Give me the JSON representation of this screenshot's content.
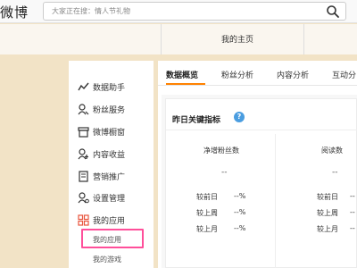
{
  "header": {
    "logo_text": "微博",
    "search_placeholder": "大家正在搜：情人节礼物"
  },
  "nav": {
    "my_home": "我的主页"
  },
  "sidebar": {
    "items": [
      {
        "label": "数据助手",
        "icon": "chart-line-icon"
      },
      {
        "label": "粉丝服务",
        "icon": "fans-icon"
      },
      {
        "label": "微博橱窗",
        "icon": "shop-window-icon"
      },
      {
        "label": "内容收益",
        "icon": "income-icon"
      },
      {
        "label": "营销推广",
        "icon": "promotion-icon"
      },
      {
        "label": "设置管理",
        "icon": "settings-icon"
      },
      {
        "label": "我的应用",
        "icon": "apps-icon"
      }
    ],
    "sub_items": [
      {
        "label": "我的应用"
      },
      {
        "label": "我的游戏"
      }
    ]
  },
  "tabs": [
    {
      "label": "数据概览",
      "active": true
    },
    {
      "label": "粉丝分析",
      "active": false
    },
    {
      "label": "内容分析",
      "active": false
    },
    {
      "label": "互动分",
      "active": false
    }
  ],
  "card": {
    "title": "昨日关键指标",
    "columns": [
      {
        "header": "净增粉丝数",
        "value": "--",
        "compare": [
          {
            "label": "较前日",
            "value": "--%"
          },
          {
            "label": "较上周",
            "value": "--%"
          },
          {
            "label": "较上月",
            "value": "--%"
          }
        ]
      },
      {
        "header": "阅读数",
        "value": "--",
        "compare": [
          {
            "label": "较前日",
            "value": "--"
          },
          {
            "label": "较上周",
            "value": "--"
          },
          {
            "label": "较上月",
            "value": "--"
          }
        ]
      }
    ]
  },
  "colors": {
    "accent_orange": "#ff8200",
    "highlight_pink": "#ff4f9a",
    "help_blue": "#4a9de0"
  }
}
